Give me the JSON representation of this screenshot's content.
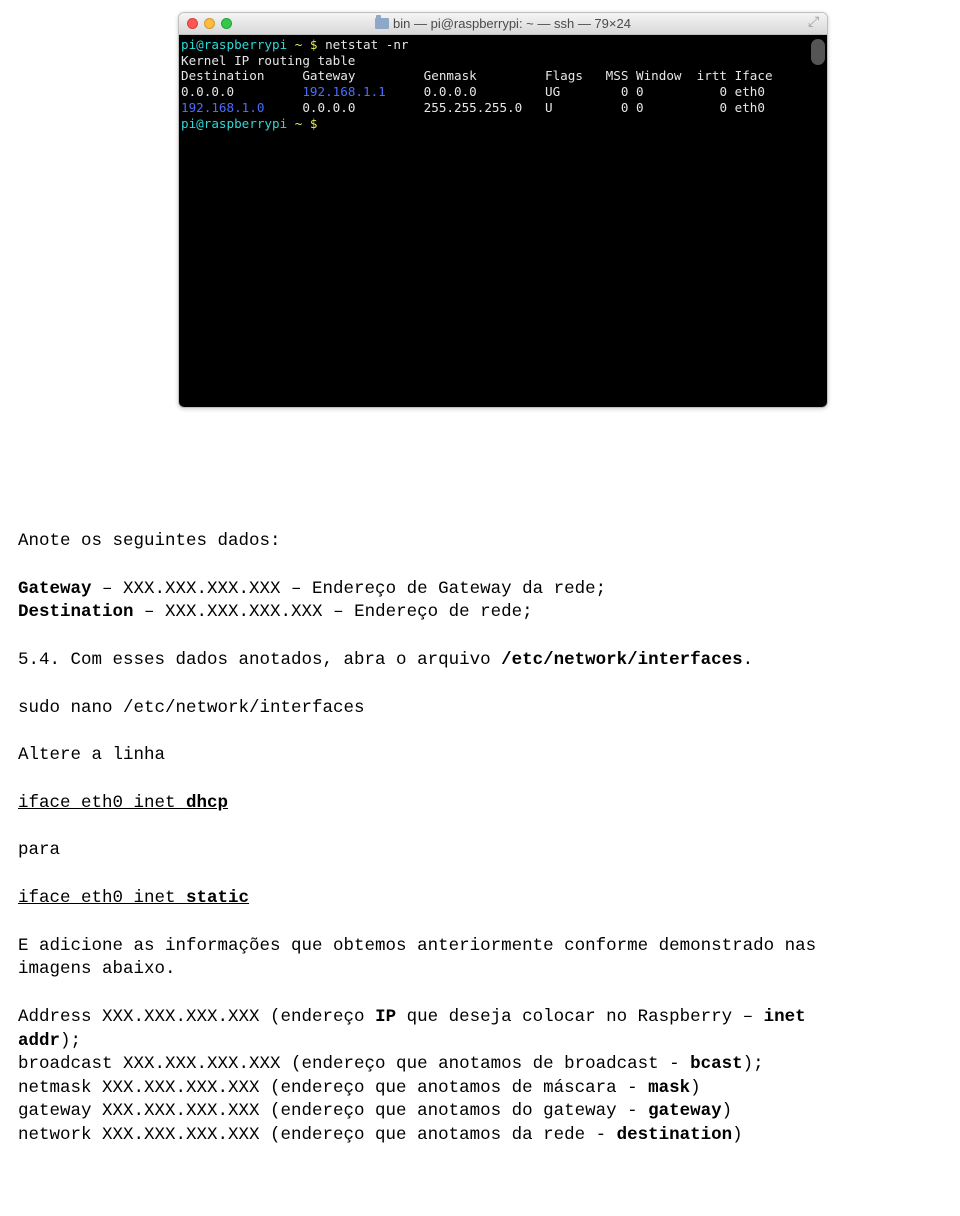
{
  "terminal": {
    "title": "bin — pi@raspberrypi: ~ — ssh — 79×24",
    "prompt_user": "pi@raspberrypi",
    "prompt_sep": " ~ $ ",
    "cmd": "netstat -nr",
    "line2": "Kernel IP routing table",
    "header": {
      "c1": "Destination",
      "c2": "Gateway",
      "c3": "Genmask",
      "c4": "Flags",
      "c5": "MSS",
      "c6": "Window",
      "c7": "irtt",
      "c8": "Iface"
    },
    "row1": {
      "dest": "0.0.0.0",
      "gw": "192.168.1.1",
      "mask": "0.0.0.0",
      "flags": "UG",
      "mss": "0",
      "win": "0",
      "irtt": "0",
      "iface": "eth0"
    },
    "row2": {
      "dest": "192.168.1.0",
      "gw": "0.0.0.0",
      "mask": "255.255.255.0",
      "flags": "U",
      "mss": "0",
      "win": "0",
      "irtt": "0",
      "iface": "eth0"
    }
  },
  "doc": {
    "p1": "Anote os seguintes dados:",
    "gw_lbl": "Gateway",
    "gw_dash": " – XXX.XXX.XXX.XXX – Endereço de Gateway da rede;",
    "dest_lbl": "Destination",
    "dest_dash": " – XXX.XXX.XXX.XXX – Endereço de rede;",
    "p4_a": "5.4. Com esses dados anotados, abra o arquivo ",
    "p4_b": "/etc/network/interfaces",
    "p4_c": ".",
    "p5": "sudo nano /etc/network/interfaces",
    "p6": "Altere a linha",
    "l7a": "iface eth0 inet ",
    "l7b": "dhcp",
    "p8": "para",
    "l9a": "iface eth0 inet ",
    "l9b": "static",
    "p10a": "E adicione as informações que obtemos anteriormente conforme demonstrado nas",
    "p10b": "imagens abaixo.",
    "addr1a": "Address XXX.XXX.XXX.XXX (endereço ",
    "addr1b": "IP",
    "addr1c": " que deseja colocar no Raspberry – ",
    "addr1d": "inet",
    "addr2a": "addr",
    "addr2b": ");",
    "bcast_a": "broadcast XXX.XXX.XXX.XXX (endereço que anotamos de broadcast - ",
    "bcast_b": "bcast",
    "bcast_c": ");",
    "mask_a": "netmask XXX.XXX.XXX.XXX (endereço que anotamos de máscara - ",
    "mask_b": "mask",
    "mask_c": ")",
    "gw2_a": "gateway XXX.XXX.XXX.XXX (endereço que anotamos do gateway - ",
    "gw2_b": "gateway",
    "gw2_c": ")",
    "net_a": "network XXX.XXX.XXX.XXX (endereço que anotamos da rede - ",
    "net_b": "destination",
    "net_c": ")"
  }
}
